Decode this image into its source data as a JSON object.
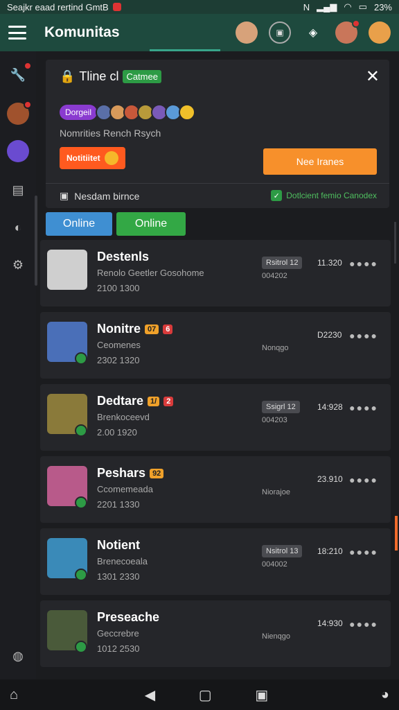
{
  "status_bar": {
    "left_text": "Seajkr eaad rertind GmtB",
    "right_text": "23%"
  },
  "app_bar": {
    "title": "Komunitas"
  },
  "top_card": {
    "title": "Tline cl",
    "title_tag": "Catmee",
    "avatar_pill": "Dorgeil",
    "subtitle": "Nomrities Rench Rsych",
    "orange_pill": "Notitiitet",
    "action_button": "Nee Iranes",
    "footer_left": "Nesdam birnce",
    "footer_right": "Dotlcient femio Canodex"
  },
  "filters": [
    {
      "label": "Online",
      "color": "#3f8fd2"
    },
    {
      "label": "Online",
      "color": "#33a845"
    }
  ],
  "rows": [
    {
      "name": "Destenls",
      "sub": "Renolo Geetler Gosohome",
      "date": "2100 1300",
      "meta_tag": "Rsitrol 12",
      "meta_sub": "004202",
      "time": "11.320",
      "online": false,
      "thumb": "#cfcfcf",
      "badges": []
    },
    {
      "name": "Nonitre",
      "sub": "Ceomenes",
      "date": "2302 1320",
      "meta_tag": "",
      "meta_sub": "Nonqgo",
      "time": "D2230",
      "online": true,
      "thumb": "#4a6fb8",
      "badges": [
        {
          "type": "o",
          "text": "07"
        },
        {
          "type": "r",
          "text": "6"
        }
      ]
    },
    {
      "name": "Dedtare",
      "sub": "Brenkoceevd",
      "date": "2.00 1920",
      "meta_tag": "Ssigrl 12",
      "meta_sub": "004203",
      "time": "14:928",
      "online": true,
      "thumb": "#8a7a3a",
      "badges": [
        {
          "type": "o",
          "text": "1/"
        },
        {
          "type": "r",
          "text": "2"
        }
      ]
    },
    {
      "name": "Peshars",
      "sub": "Ccomemeada",
      "date": "2201 1330",
      "meta_tag": "",
      "meta_sub": "Niorajoe",
      "time": "23.910",
      "online": true,
      "thumb": "#b85a8a",
      "badges": [
        {
          "type": "o",
          "text": "92"
        }
      ]
    },
    {
      "name": "Notient",
      "sub": "Brenecoeala",
      "date": "1301 2330",
      "meta_tag": "Nsitrol 13",
      "meta_sub": "004002",
      "time": "18:210",
      "online": true,
      "thumb": "#3a8ab8",
      "badges": []
    },
    {
      "name": "Preseache",
      "sub": "Geccrebre",
      "date": "1012 2530",
      "meta_tag": "",
      "meta_sub": "Nienqgo",
      "time": "14:930",
      "online": true,
      "thumb": "#4a5a3a",
      "badges": []
    }
  ]
}
